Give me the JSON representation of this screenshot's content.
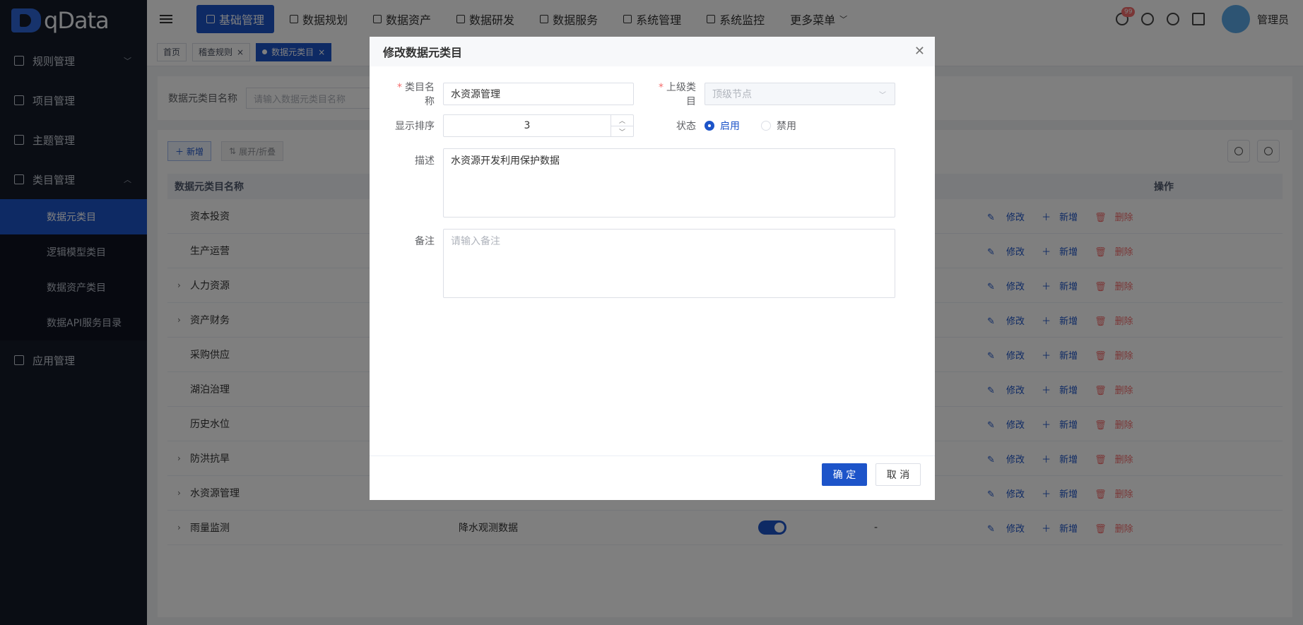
{
  "app": {
    "logo_text": "qData"
  },
  "sidebar": {
    "items": [
      {
        "label": "规则管理",
        "expanded": false
      },
      {
        "label": "项目管理"
      },
      {
        "label": "主题管理"
      },
      {
        "label": "类目管理",
        "expanded": true
      },
      {
        "label": "应用管理"
      }
    ],
    "sub_items": [
      {
        "label": "数据元类目",
        "active": true
      },
      {
        "label": "逻辑模型类目"
      },
      {
        "label": "数据资产类目"
      },
      {
        "label": "数据API服务目录"
      }
    ]
  },
  "topnav": {
    "items": [
      {
        "label": "基础管理",
        "active": true
      },
      {
        "label": "数据规划"
      },
      {
        "label": "数据资产"
      },
      {
        "label": "数据研发"
      },
      {
        "label": "数据服务"
      },
      {
        "label": "系统管理"
      },
      {
        "label": "系统监控"
      },
      {
        "label": "更多菜单"
      }
    ],
    "notification_badge": "99",
    "user_name": "管理员"
  },
  "tags": [
    {
      "label": "首页"
    },
    {
      "label": "稽查规则"
    },
    {
      "label": "数据元类目",
      "active": true
    }
  ],
  "filter": {
    "label": "数据元类目名称",
    "placeholder": "请输入数据元类目名称"
  },
  "toolbar": {
    "new_label": "新增",
    "expand_label": "展开/折叠"
  },
  "table": {
    "header_name": "数据元类目名称",
    "header_ops": "操作",
    "op_edit": "修改",
    "op_add": "新增",
    "op_delete": "删除",
    "rows": [
      {
        "name": "资本投资",
        "expandable": false
      },
      {
        "name": "生产运营",
        "expandable": false
      },
      {
        "name": "人力资源",
        "expandable": true
      },
      {
        "name": "资产财务",
        "expandable": true
      },
      {
        "name": "采购供应",
        "expandable": false
      },
      {
        "name": "湖泊治理",
        "expandable": false
      },
      {
        "name": "历史水位",
        "expandable": false
      },
      {
        "name": "防洪抗旱",
        "expandable": true
      },
      {
        "name": "水资源管理",
        "expandable": true
      },
      {
        "name": "雨量监测",
        "expandable": true,
        "desc": "降水观测数据",
        "status_on": true,
        "remark": "-"
      }
    ]
  },
  "modal": {
    "title": "修改数据元类目",
    "name_label": "类目名称",
    "name_value": "水资源管理",
    "parent_label": "上级类目",
    "parent_placeholder": "顶级节点",
    "order_label": "显示排序",
    "order_value": "3",
    "status_label": "状态",
    "status_on_label": "启用",
    "status_off_label": "禁用",
    "status_value": "启用",
    "desc_label": "描述",
    "desc_value": "水资源开发利用保护数据",
    "remark_label": "备注",
    "remark_placeholder": "请输入备注",
    "ok_label": "确 定",
    "cancel_label": "取 消"
  },
  "colors": {
    "primary": "#1d54c9",
    "sidebar_bg": "#141a28",
    "danger": "#f56c6c"
  }
}
